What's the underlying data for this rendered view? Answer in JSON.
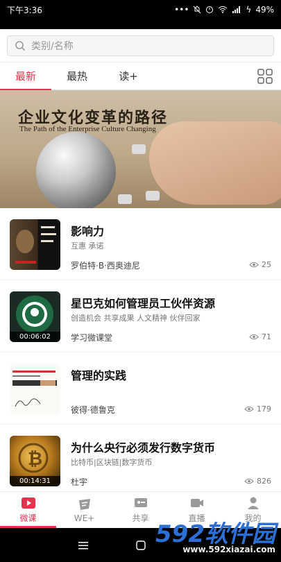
{
  "status": {
    "time": "下午3:36",
    "battery": "49%"
  },
  "search": {
    "placeholder": "类别/名称"
  },
  "tabs": [
    {
      "label": "最新",
      "active": true
    },
    {
      "label": "最热",
      "active": false
    },
    {
      "label": "读+",
      "active": false
    }
  ],
  "banner": {
    "title": "企业文化变革的路径",
    "subtitle": "The Path of the Enterprise Culture Changing"
  },
  "items": [
    {
      "title": "影响力",
      "tags": "互惠  承诺",
      "author": "罗伯特·B·西奥迪尼",
      "views": "25",
      "duration": ""
    },
    {
      "title": "星巴克如何管理员工伙伴资源",
      "tags": "创造机会 共享成果 人文精神  伙伴回家",
      "author": "学习微课堂",
      "views": "71",
      "duration": "00:06:02"
    },
    {
      "title": "管理的实践",
      "tags": "",
      "author": "彼得·德鲁克",
      "views": "179",
      "duration": ""
    },
    {
      "title": "为什么央行必须发行数字货币",
      "tags": "比特币|区块链|数字货币",
      "author": "杜宇",
      "views": "826",
      "duration": "00:14:31"
    }
  ],
  "nav": [
    {
      "label": "微课",
      "icon": "play-icon",
      "active": true
    },
    {
      "label": "WE+",
      "icon": "we-icon",
      "active": false
    },
    {
      "label": "共享",
      "icon": "share-icon",
      "active": false
    },
    {
      "label": "直播",
      "icon": "video-icon",
      "active": false
    },
    {
      "label": "我的",
      "icon": "user-icon",
      "active": false
    }
  ],
  "watermark": {
    "brand": "592软件园",
    "url": "www.592xiazai.com"
  },
  "colors": {
    "accent": "#e0344f"
  }
}
